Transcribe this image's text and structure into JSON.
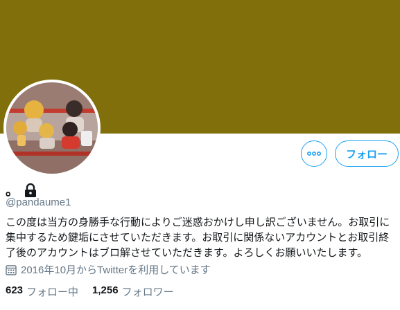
{
  "profile": {
    "banner_color": "#806f0b",
    "display_name": "。",
    "handle": "@pandaume1",
    "bio": "この度は当方の身勝手な行動によりご迷惑おかけし申し訳ございません。お取引に集中するため鍵垢にさせていただきます。お取引に関係ないアカウントとお取引終了後のアカウントはブロ解させていただきます。よろしくお願いいたします。",
    "joined": "2016年10月からTwitterを利用しています",
    "protected_icon": "lock-icon"
  },
  "actions": {
    "more_icon": "more-icon",
    "follow_label": "フォロー"
  },
  "stats": {
    "following_count": "623",
    "following_label": "フォロー中",
    "followers_count": "1,256",
    "followers_label": "フォロワー"
  },
  "colors": {
    "accent": "#1da1f2",
    "secondary_text": "#657786",
    "primary_text": "#14171a"
  }
}
